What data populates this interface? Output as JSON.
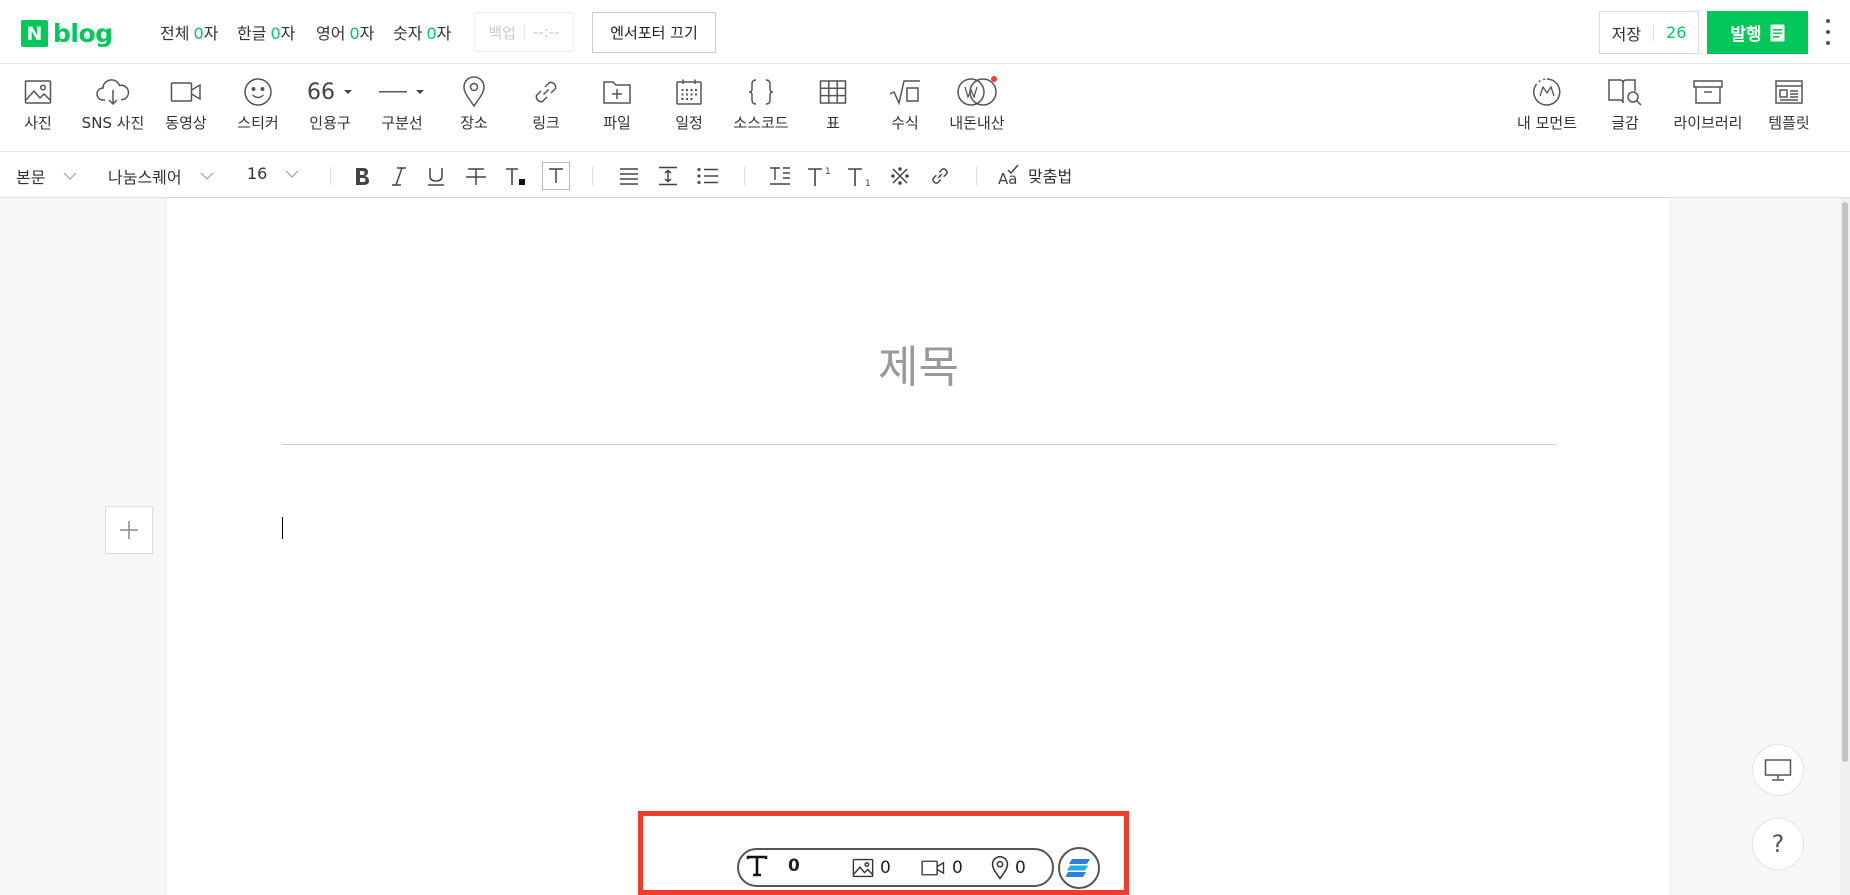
{
  "app": {
    "logo_letter": "N",
    "logo_text": "blog"
  },
  "counters": [
    {
      "label": "전체",
      "value": "0",
      "unit": "자"
    },
    {
      "label": "한글",
      "value": "0",
      "unit": "자"
    },
    {
      "label": "영어",
      "value": "0",
      "unit": "자"
    },
    {
      "label": "숫자",
      "value": "0",
      "unit": "자"
    }
  ],
  "backup": {
    "label": "백업",
    "time": "--:--"
  },
  "enter_label": "엔서포터 끄기",
  "save": {
    "label": "저장",
    "count": "26"
  },
  "publish": {
    "label": "발행"
  },
  "toolbar": {
    "items": [
      {
        "label": "사진",
        "icon": "photo-icon"
      },
      {
        "label": "SNS 사진",
        "icon": "cloud-icon"
      },
      {
        "label": "동영상",
        "icon": "video-icon"
      },
      {
        "label": "스티커",
        "icon": "sticker-icon"
      },
      {
        "label": "인용구",
        "icon": "quote-icon"
      },
      {
        "label": "구분선",
        "icon": "divider-icon"
      },
      {
        "label": "장소",
        "icon": "place-icon"
      },
      {
        "label": "링크",
        "icon": "link-icon"
      },
      {
        "label": "파일",
        "icon": "file-icon"
      },
      {
        "label": "일정",
        "icon": "calendar-icon"
      },
      {
        "label": "소스코드",
        "icon": "code-icon"
      },
      {
        "label": "표",
        "icon": "table-icon"
      },
      {
        "label": "수식",
        "icon": "formula-icon"
      },
      {
        "label": "내돈내산",
        "icon": "wallet-icon"
      }
    ],
    "right_items": [
      {
        "label": "내 모먼트",
        "icon": "moment-icon"
      },
      {
        "label": "글감",
        "icon": "book-search-icon"
      },
      {
        "label": "라이브러리",
        "icon": "archive-icon"
      },
      {
        "label": "템플릿",
        "icon": "template-icon"
      }
    ],
    "quote_mark": "66",
    "accent_color": "#03c75a",
    "notify_color": "#ff3b30"
  },
  "format": {
    "paragraph": "본문",
    "font": "나눔스퀘어",
    "size": "16",
    "spell_label": "맞춤법"
  },
  "editor": {
    "title_placeholder": "제목"
  },
  "stats": {
    "text_count": "0",
    "image_count": "0",
    "video_count": "0",
    "place_count": "0",
    "highlight_color": "#f03c2e"
  },
  "help_label": "?"
}
